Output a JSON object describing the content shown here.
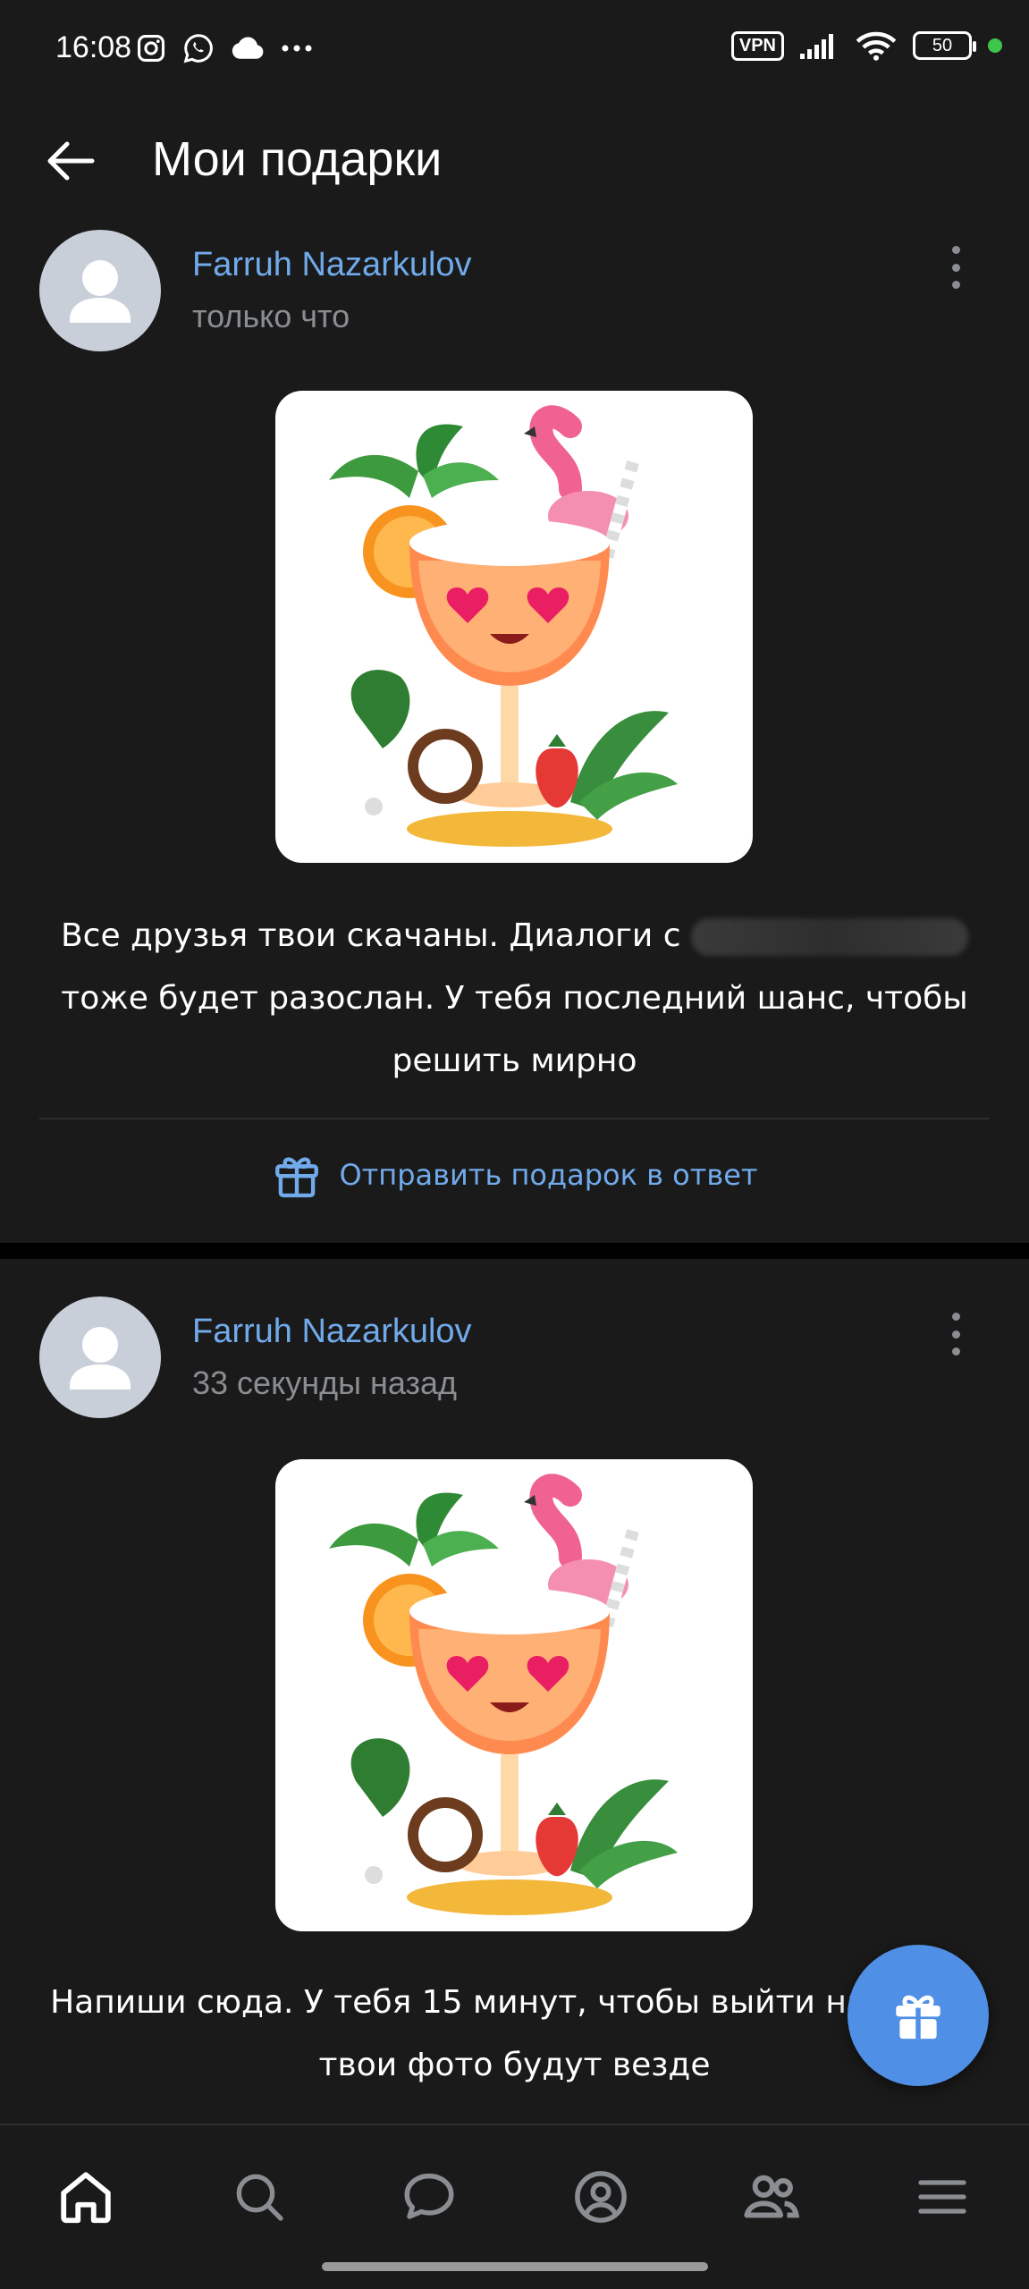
{
  "status_bar": {
    "time": "16:08",
    "left_icons": [
      "instagram-icon",
      "whatsapp-icon",
      "cloud-icon",
      "more-dots-icon"
    ],
    "vpn_label": "VPN",
    "battery_level": "50",
    "colors": {
      "dot": "#3ec54a"
    }
  },
  "header": {
    "title": "Мои подарки"
  },
  "gifts": [
    {
      "author": "Farruh Nazarkulov",
      "time": "только что",
      "message_part1": "Все друзья твои скачаны. Диалоги с",
      "message_part2": "тоже будет разослан. У тебя последний шанс, чтобы решить мирно",
      "reply_label": "Отправить подарок в ответ"
    },
    {
      "author": "Farruh Nazarkulov",
      "time": "33 секунды назад",
      "message": "Напиши сюда. У тебя 15 минут, чтобы выйти на связь, твои фото будут везде"
    }
  ],
  "bottom_nav": {
    "items": [
      "home-icon",
      "search-icon",
      "messages-icon",
      "profile-icon",
      "friends-icon",
      "menu-icon"
    ],
    "active": "home-icon"
  },
  "colors": {
    "accent": "#71aaeb",
    "background": "#1a1a1a",
    "fab": "#4f8fe6"
  }
}
